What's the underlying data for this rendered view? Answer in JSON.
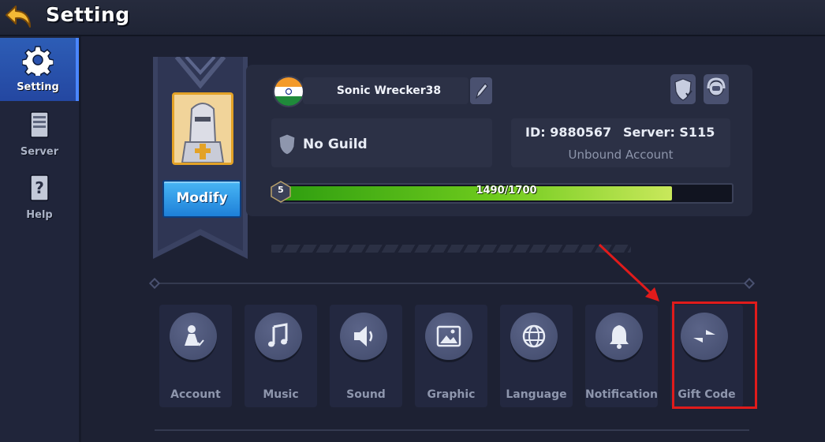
{
  "header": {
    "title": "Setting"
  },
  "sidebar": {
    "items": [
      {
        "label": "Setting",
        "icon": "gear-icon",
        "active": true
      },
      {
        "label": "Server",
        "icon": "server-icon",
        "active": false
      },
      {
        "label": "Help",
        "icon": "help-icon",
        "active": false
      }
    ]
  },
  "profile": {
    "name": "Sonic Wrecker38",
    "flag": "india-flag-icon",
    "guild": "No Guild",
    "id": "ID: 9880567",
    "server": "Server: S115",
    "account_status": "Unbound Account",
    "level": "5",
    "xp_text": "1490/1700",
    "xp_fraction": 0.876,
    "modify_label": "Modify"
  },
  "options": [
    {
      "label": "Account",
      "icon": "account-icon"
    },
    {
      "label": "Music",
      "icon": "music-note-icon"
    },
    {
      "label": "Sound",
      "icon": "speaker-icon"
    },
    {
      "label": "Graphic",
      "icon": "image-icon"
    },
    {
      "label": "Language",
      "icon": "globe-icon"
    },
    {
      "label": "Notification",
      "icon": "bell-icon"
    },
    {
      "label": "Gift Code",
      "icon": "gift-code-icon"
    }
  ],
  "colors": {
    "accent_blue": "#2d5db6",
    "xp_green": "#6fcb1d",
    "highlight_red": "#e01b1b"
  }
}
